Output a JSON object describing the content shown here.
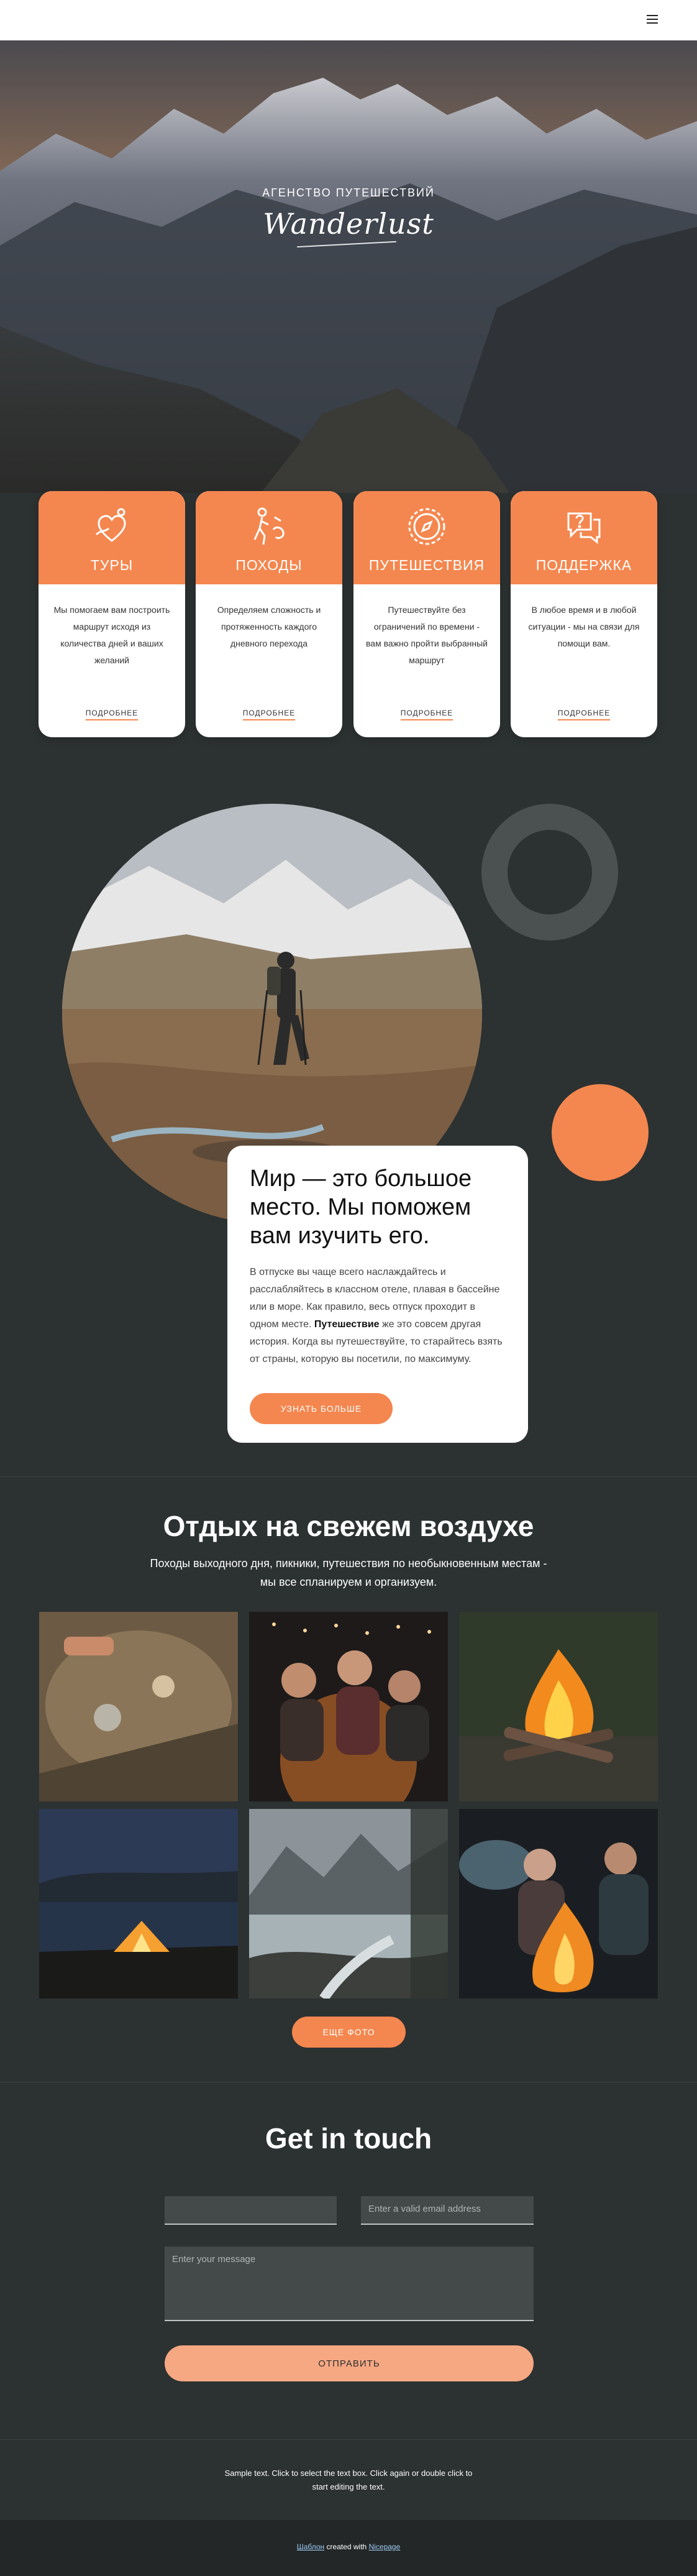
{
  "header": {
    "menu_icon": "hamburger-menu-icon"
  },
  "hero": {
    "subtitle": "АГЕНСТВО ПУТЕШЕСТВИЙ",
    "logo": "Wanderlust"
  },
  "cards": [
    {
      "icon": "heart-route-icon",
      "title": "ТУРЫ",
      "text": "Мы помогаем вам построить маршрут исходя из количества дней и ваших желаний",
      "link": "ПОДРОБНЕЕ"
    },
    {
      "icon": "hiker-icon",
      "title": "ПОХОДЫ",
      "text": "Определяем сложность и протяженность каждого дневного перехода",
      "link": "ПОДРОБНЕЕ"
    },
    {
      "icon": "compass-icon",
      "title": "ПУТЕШЕСТВИЯ",
      "text": "Путешествуйте без ограничений по времени - вам важно пройти выбранный маршрут",
      "link": "ПОДРОБНЕЕ"
    },
    {
      "icon": "chat-question-icon",
      "title": "ПОДДЕРЖКА",
      "text": "В любое время и в любой ситуации - мы на связи для помощи вам.",
      "link": "ПОДРОБНЕЕ"
    }
  ],
  "about": {
    "title": "Мир — это большое место. Мы поможем вам изучить его.",
    "text_before": "В отпуске вы чаще всего наслаждайтесь и расслабляйтесь в классном отеле, плавая в бассейне или в море. Как правило, весь отпуск проходит в одном месте. ",
    "text_bold": "Путешествие",
    "text_after": " же это совсем другая история. Когда вы путешествуйте, то старайтесь взять от страны, которую вы посетили, по максимуму.",
    "button": "УЗНАТЬ БОЛЬШЕ"
  },
  "outdoor": {
    "title": "Отдых на свежем воздухе",
    "subtitle": "Походы выходного дня, пикники, путешествия по необыкновенным местам - мы все спланируем и организуем.",
    "button": "ЕЩЕ ФОТО"
  },
  "contact": {
    "title": "Get in touch",
    "name_placeholder": "",
    "email_placeholder": "Enter a valid email address",
    "message_placeholder": "Enter your message",
    "submit": "ОТПРАВИТЬ"
  },
  "footer": {
    "text": "Sample text. Click to select the text box. Click again or double click to start editing the text.",
    "credit_link1": "Шаблон",
    "credit_mid": " created with ",
    "credit_link2": "Nicepage"
  },
  "colors": {
    "accent": "#f4874f",
    "background": "#2c3131",
    "ring": "#4b5151"
  }
}
